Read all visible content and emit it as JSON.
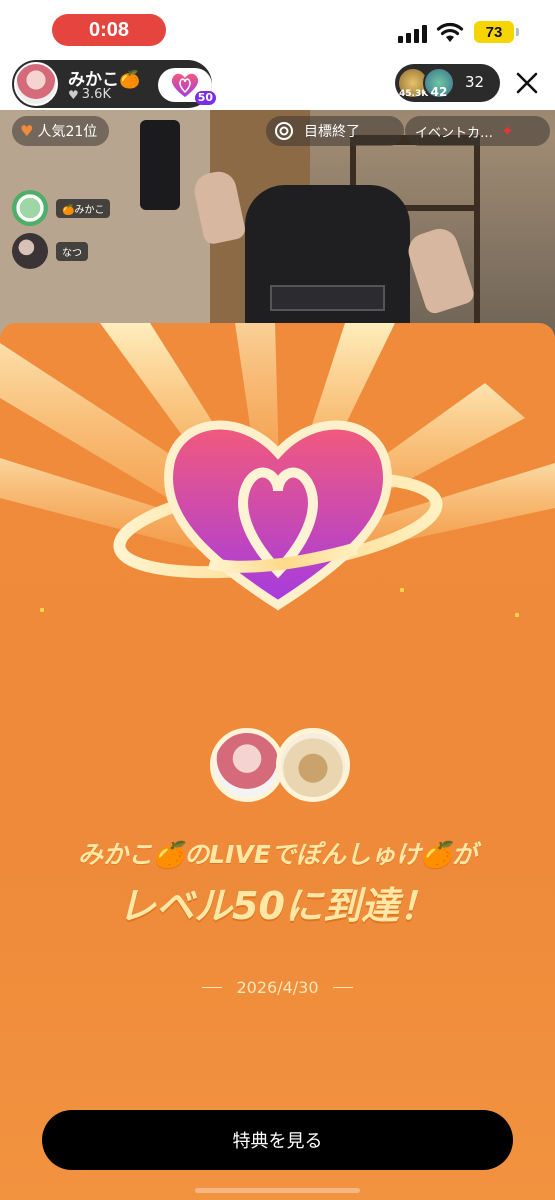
{
  "status_bar": {
    "time": "0:08",
    "battery": "73"
  },
  "host": {
    "name": "みかこ🍊",
    "likes": "3.6K",
    "level": "50"
  },
  "viewers": {
    "avatar_badges": [
      "45.3K",
      "42"
    ],
    "count": "32"
  },
  "overlay": {
    "rank": "人気21位",
    "goal_label": "目標終了",
    "event_label": "イベントカ…"
  },
  "chat": [
    {
      "badge": "🍊みかこ"
    },
    {
      "badge": "なつ"
    }
  ],
  "modal": {
    "message_line1": "みかこ🍊のLIVEでぽんしゅけ🍊が",
    "message_line2": "レベル50に到達！",
    "date": "2026/4/30",
    "cta_label": "特典を見る"
  },
  "colors": {
    "modal_bg": "#f08b3c",
    "text_gold": "#ffe7a6",
    "time_pill": "#e5453e",
    "battery": "#f5d400",
    "heart_top": "#f25a7c",
    "heart_bottom": "#a53be0"
  }
}
